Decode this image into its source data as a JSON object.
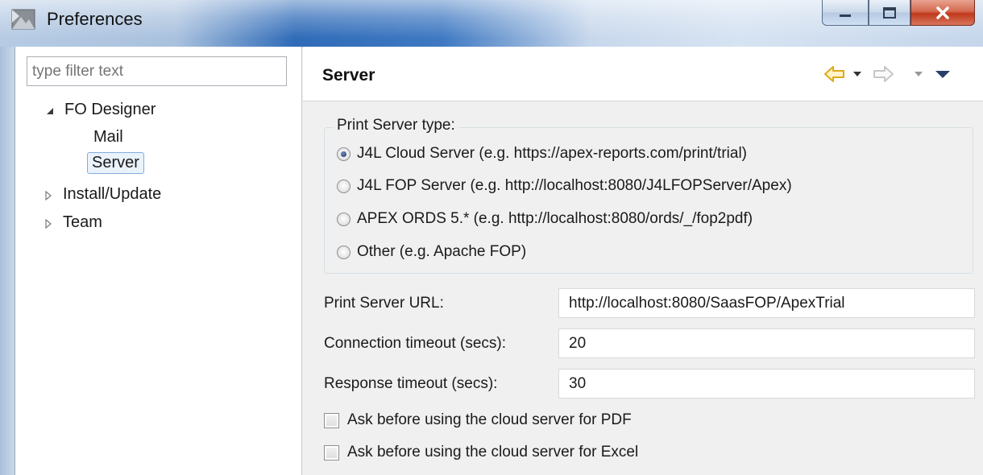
{
  "window": {
    "title": "Preferences",
    "controls": [
      "minimize",
      "maximize",
      "close"
    ]
  },
  "sidebar": {
    "filter_placeholder": "type filter text",
    "tree": [
      {
        "label": "FO Designer",
        "expanded": true,
        "children": [
          {
            "label": "Mail",
            "selected": false
          },
          {
            "label": "Server",
            "selected": true
          }
        ]
      },
      {
        "label": "Install/Update",
        "expanded": false
      },
      {
        "label": "Team",
        "expanded": false
      }
    ]
  },
  "page": {
    "title": "Server",
    "nav": {
      "back": "back-arrow",
      "forward": "forward-arrow",
      "menu": "view-menu"
    },
    "print_server_type": {
      "legend": "Print Server type:",
      "options": [
        {
          "label": "J4L Cloud Server (e.g. https://apex-reports.com/print/trial)",
          "checked": true
        },
        {
          "label": "J4L FOP Server (e.g. http://localhost:8080/J4LFOPServer/Apex)",
          "checked": false
        },
        {
          "label": "APEX ORDS 5.* (e.g. http://localhost:8080/ords/_/fop2pdf)",
          "checked": false
        },
        {
          "label": "Other (e.g. Apache FOP)",
          "checked": false
        }
      ]
    },
    "fields": [
      {
        "label": "Print Server URL:",
        "value": "http://localhost:8080/SaasFOP/ApexTrial"
      },
      {
        "label": "Connection timeout (secs):",
        "value": "20"
      },
      {
        "label": "Response timeout (secs):",
        "value": "30"
      }
    ],
    "checkboxes": [
      {
        "label": "Ask before using the cloud server for PDF",
        "checked": false
      },
      {
        "label": "Ask before using the cloud server for Excel",
        "checked": false
      }
    ]
  },
  "colors": {
    "accent_arrow": "#e8b325",
    "selection_border": "#84acdd",
    "selection_bg": "#eaf2fc",
    "close_button": "#c0391c"
  }
}
